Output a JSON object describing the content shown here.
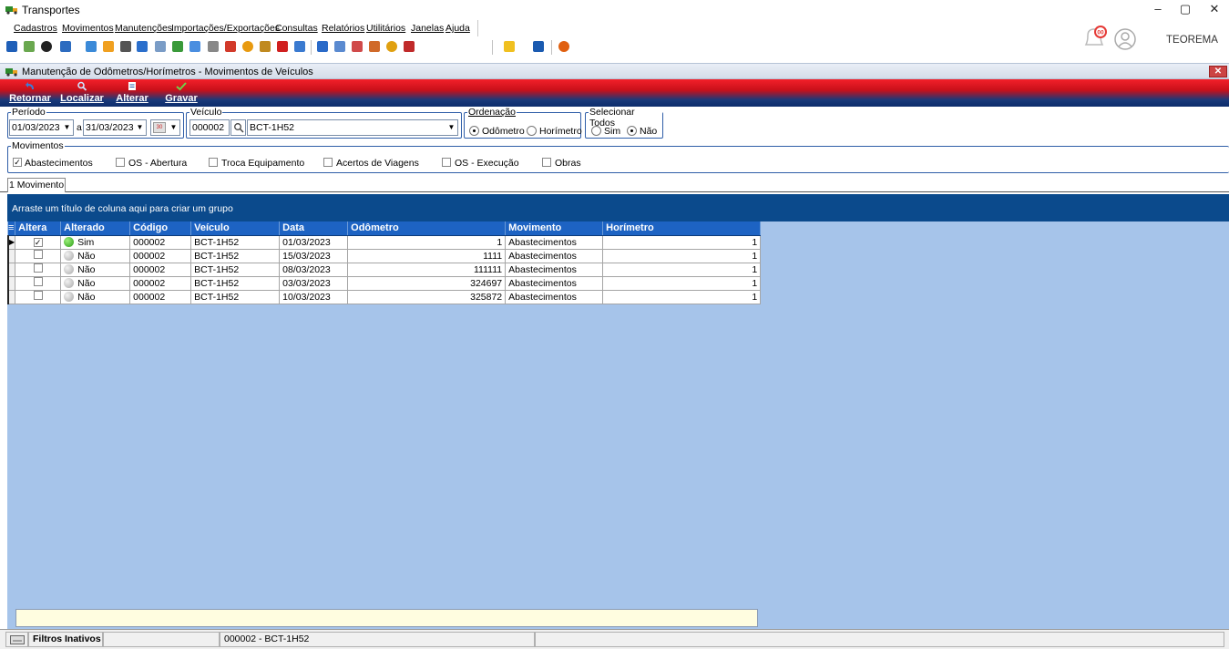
{
  "window": {
    "title": "Transportes",
    "company": "TEOREMA",
    "notifications_badge": "00"
  },
  "menu": [
    {
      "label": "Cadastros"
    },
    {
      "label": "Movimentos"
    },
    {
      "label": "Manutenções"
    },
    {
      "label": "Importações/Exportações"
    },
    {
      "label": "Consultas"
    },
    {
      "label": "Relatórios"
    },
    {
      "label": "Utilitários"
    },
    {
      "label": "Janelas"
    },
    {
      "label": "Ajuda"
    }
  ],
  "child_window": {
    "title": "Manutenção de Odômetros/Horímetros - Movimentos de Veículos",
    "close_glyph": "✕"
  },
  "actions": {
    "retornar": "Retornar",
    "localizar": "Localizar",
    "alterar": "Alterar",
    "gravar": "Gravar"
  },
  "filters": {
    "periodo": {
      "title": "Período",
      "from": "01/03/2023",
      "sep": "a",
      "to": "31/03/2023"
    },
    "veiculo": {
      "title": "Veículo",
      "code": "000002",
      "name": "BCT-1H52"
    },
    "ordenacao": {
      "title": "Ordenação",
      "options": [
        "Odômetro",
        "Horímetro"
      ],
      "selected": "Odômetro"
    },
    "selecionar_todos": {
      "title": "Selecionar Todos",
      "options": [
        "Sim",
        "Não"
      ],
      "selected": "Não"
    },
    "movimentos": {
      "title": "Movimentos",
      "items": [
        {
          "label": "Abastecimentos",
          "checked": true
        },
        {
          "label": "OS - Abertura",
          "checked": false
        },
        {
          "label": "Troca Equipamento",
          "checked": false
        },
        {
          "label": "Acertos de Viagens",
          "checked": false
        },
        {
          "label": "OS - Execução",
          "checked": false
        },
        {
          "label": "Obras",
          "checked": false
        }
      ]
    }
  },
  "tabs": [
    {
      "label": "1 Movimento"
    }
  ],
  "grid": {
    "group_hint": "Arraste um título de coluna aqui para criar um grupo",
    "columns": [
      "Altera",
      "Alterado",
      "Código",
      "Veículo",
      "Data",
      "Odômetro",
      "Movimento",
      "Horímetro"
    ],
    "rows": [
      {
        "altera": true,
        "alterado": "Sim",
        "codigo": "000002",
        "veiculo": "BCT-1H52",
        "data": "01/03/2023",
        "odometro": "1",
        "movimento": "Abastecimentos",
        "horimetro": "1"
      },
      {
        "altera": false,
        "alterado": "Não",
        "codigo": "000002",
        "veiculo": "BCT-1H52",
        "data": "15/03/2023",
        "odometro": "1111",
        "movimento": "Abastecimentos",
        "horimetro": "1"
      },
      {
        "altera": false,
        "alterado": "Não",
        "codigo": "000002",
        "veiculo": "BCT-1H52",
        "data": "08/03/2023",
        "odometro": "111111",
        "movimento": "Abastecimentos",
        "horimetro": "1"
      },
      {
        "altera": false,
        "alterado": "Não",
        "codigo": "000002",
        "veiculo": "BCT-1H52",
        "data": "03/03/2023",
        "odometro": "324697",
        "movimento": "Abastecimentos",
        "horimetro": "1"
      },
      {
        "altera": false,
        "alterado": "Não",
        "codigo": "000002",
        "veiculo": "BCT-1H52",
        "data": "10/03/2023",
        "odometro": "325872",
        "movimento": "Abastecimentos",
        "horimetro": "1"
      }
    ]
  },
  "status": {
    "filters": "Filtros Inativos",
    "vehicle": "000002 - BCT-1H52"
  },
  "colors": {
    "accent_red": "#e0121c",
    "header_blue": "#1d63c3",
    "grid_bg": "#a6c4ea",
    "group_bar": "#0b4a8c"
  }
}
